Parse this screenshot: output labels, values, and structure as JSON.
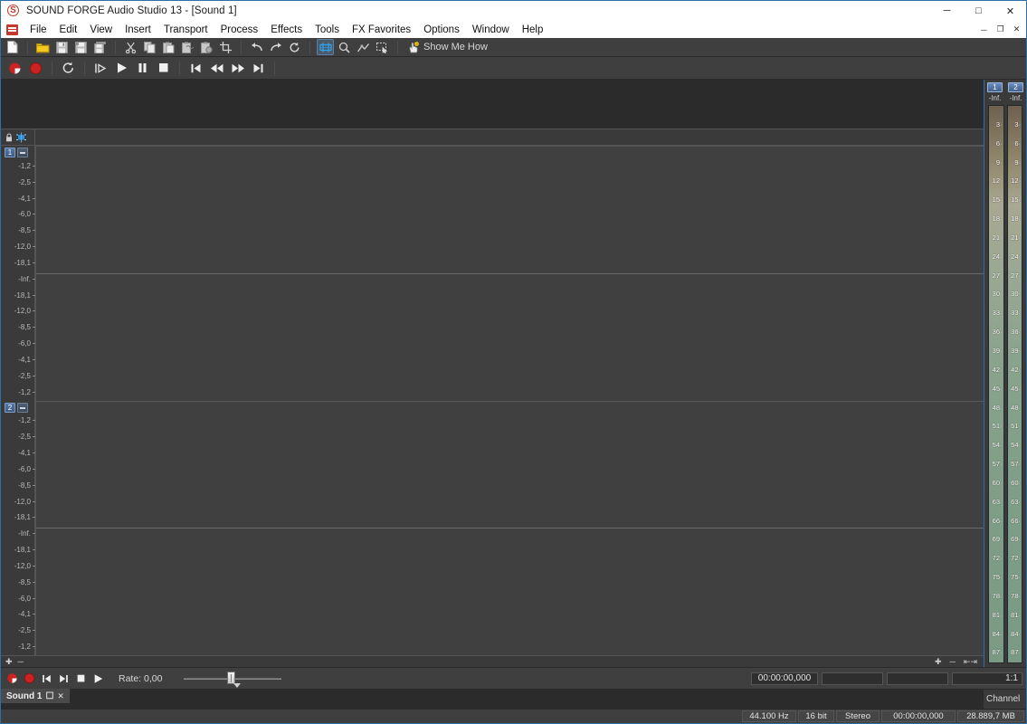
{
  "window": {
    "title": "SOUND FORGE Audio Studio 13 - [Sound 1]",
    "app_icon": "soundforge-s-icon",
    "minimize": "─",
    "maximize": "□",
    "close": "✕"
  },
  "mdi": {
    "minimize": "─",
    "restore": "❐",
    "close": "✕"
  },
  "menubar": {
    "icon": "document-menu-icon",
    "items": [
      {
        "label": "File"
      },
      {
        "label": "Edit"
      },
      {
        "label": "View"
      },
      {
        "label": "Insert"
      },
      {
        "label": "Transport"
      },
      {
        "label": "Process"
      },
      {
        "label": "Effects"
      },
      {
        "label": "Tools"
      },
      {
        "label": "FX Favorites"
      },
      {
        "label": "Options"
      },
      {
        "label": "Window"
      },
      {
        "label": "Help"
      }
    ]
  },
  "toolbar": {
    "groups": [
      {
        "buttons": [
          {
            "name": "new-file-button",
            "icon": "new-document-icon"
          }
        ]
      },
      {
        "buttons": [
          {
            "name": "open-file-button",
            "icon": "open-folder-icon"
          },
          {
            "name": "save-button",
            "icon": "save-disk-icon"
          },
          {
            "name": "save-as-button",
            "icon": "save-as-disk-icon"
          },
          {
            "name": "save-all-button",
            "icon": "save-all-disk-icon"
          }
        ]
      },
      {
        "buttons": [
          {
            "name": "cut-button",
            "icon": "scissors-icon"
          },
          {
            "name": "copy-button",
            "icon": "copy-icon"
          },
          {
            "name": "paste-button",
            "icon": "paste-icon"
          },
          {
            "name": "mix-paste-button",
            "icon": "mix-paste-icon"
          },
          {
            "name": "paste-special-button",
            "icon": "paste-special-icon"
          },
          {
            "name": "trim-crop-button",
            "icon": "crop-icon"
          }
        ]
      },
      {
        "buttons": [
          {
            "name": "undo-button",
            "icon": "undo-arrow-icon"
          },
          {
            "name": "redo-button",
            "icon": "redo-arrow-icon"
          },
          {
            "name": "repeat-button",
            "icon": "refresh-loop-icon"
          }
        ]
      },
      {
        "buttons": [
          {
            "name": "edit-tool-button",
            "icon": "edit-tool-icon",
            "active": true
          },
          {
            "name": "magnify-tool-button",
            "icon": "magnifier-icon"
          },
          {
            "name": "envelope-tool-button",
            "icon": "envelope-icon"
          },
          {
            "name": "select-tool-button",
            "icon": "selection-icon"
          }
        ]
      }
    ],
    "show_me_how": {
      "label": "Show Me How",
      "icon": "hand-pointer-help-icon"
    }
  },
  "transport": {
    "buttons": [
      {
        "name": "record-arm-button",
        "icon": "record-arm-icon"
      },
      {
        "name": "record-button",
        "icon": "record-icon"
      },
      {
        "name": "loop-playback-button",
        "icon": "loop-icon"
      },
      {
        "name": "play-selection-button",
        "icon": "play-selection-icon"
      },
      {
        "name": "play-button",
        "icon": "play-icon"
      },
      {
        "name": "pause-button",
        "icon": "pause-icon"
      },
      {
        "name": "stop-button",
        "icon": "stop-icon"
      },
      {
        "name": "go-to-start-button",
        "icon": "skip-start-icon"
      },
      {
        "name": "rewind-button",
        "icon": "rewind-icon"
      },
      {
        "name": "fast-forward-button",
        "icon": "fast-forward-icon"
      },
      {
        "name": "go-to-end-button",
        "icon": "skip-end-icon"
      }
    ]
  },
  "editor": {
    "ruler": {
      "lock_icon": "lock-icon",
      "edit_icon": "channel-edit-icon"
    },
    "channels": [
      {
        "number": "1",
        "mute_icon": "mute-icon"
      },
      {
        "number": "2",
        "mute_icon": "mute-icon"
      }
    ],
    "db_scale": [
      "-1,2",
      "-2,5",
      "-4,1",
      "-6,0",
      "-8,5",
      "-12,0",
      "-18,1",
      "-Inf.",
      "-18,1",
      "-12,0",
      "-8,5",
      "-6,0",
      "-4,1",
      "-2,5",
      "-1,2"
    ]
  },
  "meters": {
    "channels": [
      {
        "label": "1",
        "peak": "-Inf."
      },
      {
        "label": "2",
        "peak": "-Inf."
      }
    ],
    "scale": [
      "3",
      "6",
      "9",
      "12",
      "15",
      "18",
      "21",
      "24",
      "27",
      "30",
      "33",
      "36",
      "39",
      "42",
      "45",
      "48",
      "51",
      "54",
      "57",
      "60",
      "63",
      "66",
      "69",
      "72",
      "75",
      "78",
      "81",
      "84",
      "87"
    ],
    "footer_label": "Channel"
  },
  "zoomstrip": {
    "left": [
      {
        "name": "zoom-in-vertical-button",
        "glyph": "➕"
      },
      {
        "name": "zoom-out-vertical-button",
        "glyph": "➖"
      }
    ],
    "right": [
      {
        "name": "zoom-in-button",
        "glyph": "➕"
      },
      {
        "name": "zoom-out-button",
        "glyph": "➖"
      },
      {
        "name": "zoom-fit-button",
        "glyph": "⧉"
      }
    ]
  },
  "bottombar": {
    "buttons": [
      {
        "name": "record-arm-button",
        "icon": "record-arm-icon"
      },
      {
        "name": "record-button",
        "icon": "record-icon"
      },
      {
        "name": "go-to-start-button",
        "icon": "skip-start-icon"
      },
      {
        "name": "go-to-end-button",
        "icon": "skip-end-icon"
      },
      {
        "name": "stop-button",
        "icon": "stop-icon"
      },
      {
        "name": "play-button",
        "icon": "play-icon"
      }
    ],
    "rate_label": "Rate: 0,00",
    "slider": {
      "name": "playback-rate-slider",
      "value": "0,00"
    },
    "time_value": "00:00:00,000",
    "field_2": "",
    "field_3": "",
    "ratio": "1:1"
  },
  "tabbar": {
    "tabs": [
      {
        "label": "Sound 1",
        "restore_icon": "restore-icon",
        "close_icon": "close-icon"
      }
    ]
  },
  "statusbar": {
    "cells": [
      {
        "name": "sample-rate",
        "value": "44.100 Hz"
      },
      {
        "name": "bit-depth",
        "value": "16 bit"
      },
      {
        "name": "channel-mode",
        "value": "Stereo"
      },
      {
        "name": "duration",
        "value": "00:00:00,000"
      },
      {
        "name": "free-space",
        "value": "28.889,7 MB"
      }
    ]
  },
  "colors": {
    "accent": "#2f6fa8",
    "record": "#cc2222",
    "chrome": "#3f3f3f",
    "wave_bg": "#404040"
  }
}
